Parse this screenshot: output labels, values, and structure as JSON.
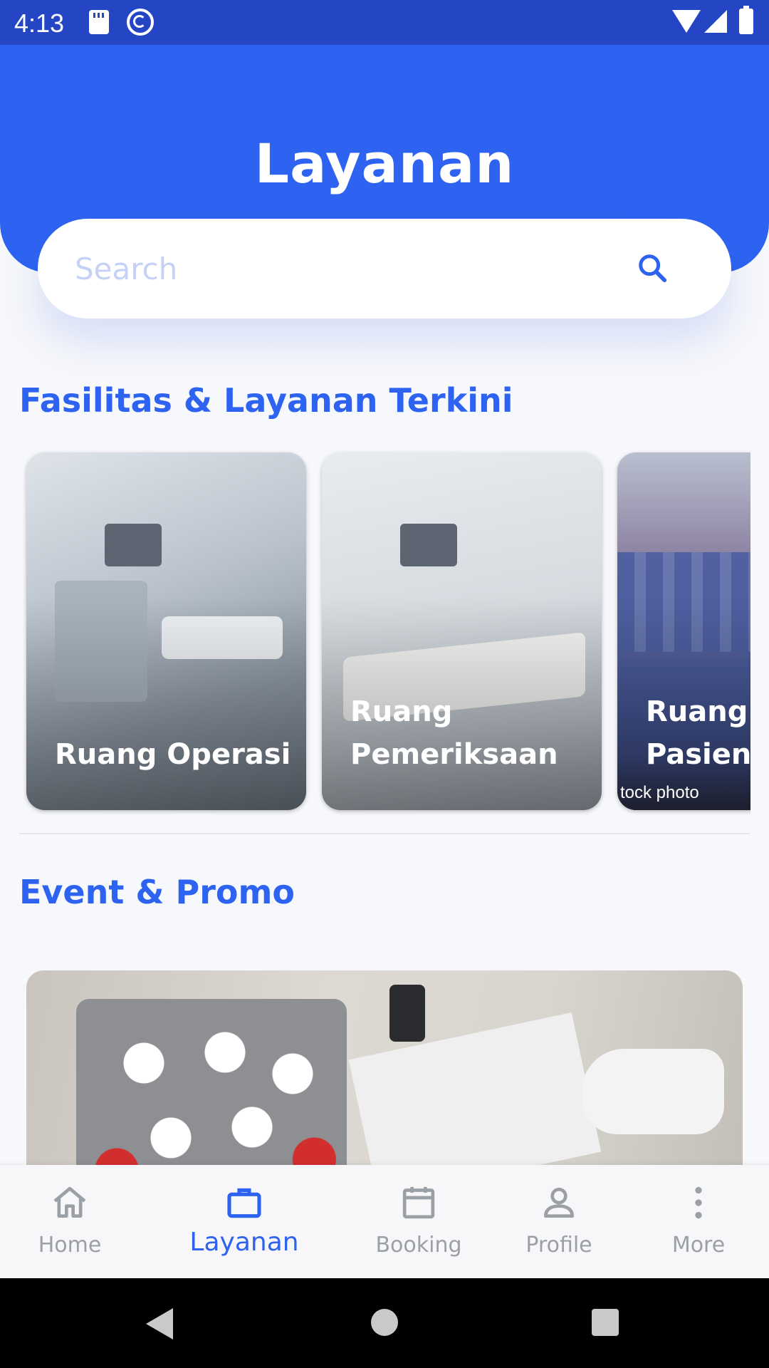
{
  "status_bar": {
    "time": "4:13"
  },
  "header": {
    "title": "Layanan"
  },
  "search": {
    "placeholder": "Search"
  },
  "sections": {
    "fasilitas_title": "Fasilitas & Layanan Terkini",
    "event_title": "Event & Promo"
  },
  "cards": [
    {
      "label": "Ruang Operasi"
    },
    {
      "label": "Ruang Pemeriksaan"
    },
    {
      "label": "Ruang T Pasien",
      "watermark": "tock photo"
    }
  ],
  "bottom_nav": {
    "items": [
      {
        "label": "Home",
        "icon": "home-icon"
      },
      {
        "label": "Layanan",
        "icon": "briefcase-icon",
        "active": true
      },
      {
        "label": "Booking",
        "icon": "calendar-icon"
      },
      {
        "label": "Profile",
        "icon": "person-icon"
      },
      {
        "label": "More",
        "icon": "more-vertical-icon"
      }
    ]
  },
  "colors": {
    "primary": "#2d63f0",
    "status_bar": "#2445c4",
    "inactive": "#9aa0a6",
    "placeholder": "#c5d1f5"
  }
}
